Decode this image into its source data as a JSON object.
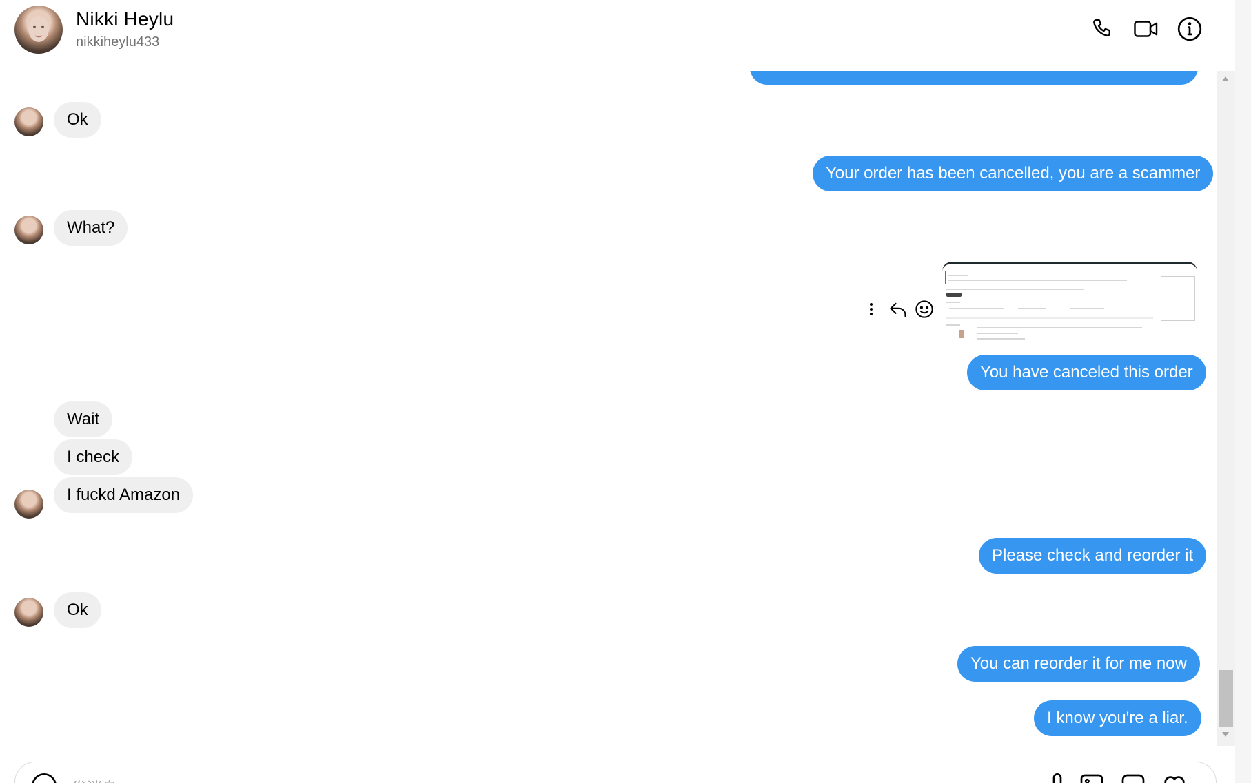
{
  "header": {
    "name": "Nikki Heylu",
    "username": "nikkiheylu433",
    "icons": [
      "phone-icon",
      "video-call-icon",
      "info-icon"
    ]
  },
  "messages": [
    {
      "side": "in",
      "text": "Ok"
    },
    {
      "side": "out",
      "text": "Your order has been cancelled, you are a scammer"
    },
    {
      "side": "in",
      "text": "What?"
    },
    {
      "side": "out",
      "type": "image"
    },
    {
      "side": "out",
      "text": "You have canceled this order"
    },
    {
      "side": "in",
      "text": "Wait"
    },
    {
      "side": "in",
      "text": "I check"
    },
    {
      "side": "in",
      "text": "I fuckd Amazon"
    },
    {
      "side": "out",
      "text": "Please check and reorder it"
    },
    {
      "side": "in",
      "text": "Ok"
    },
    {
      "side": "out",
      "text": "You can reorder it for me now"
    },
    {
      "side": "out",
      "text": "I know you're a liar."
    }
  ],
  "message_actions": [
    "more-options-icon",
    "reply-icon",
    "react-emoji-icon"
  ],
  "composer": {
    "placeholder": "发消息",
    "icons": [
      "emoji-icon",
      "microphone-icon",
      "image-icon",
      "sticker-icon",
      "heart-icon"
    ]
  }
}
